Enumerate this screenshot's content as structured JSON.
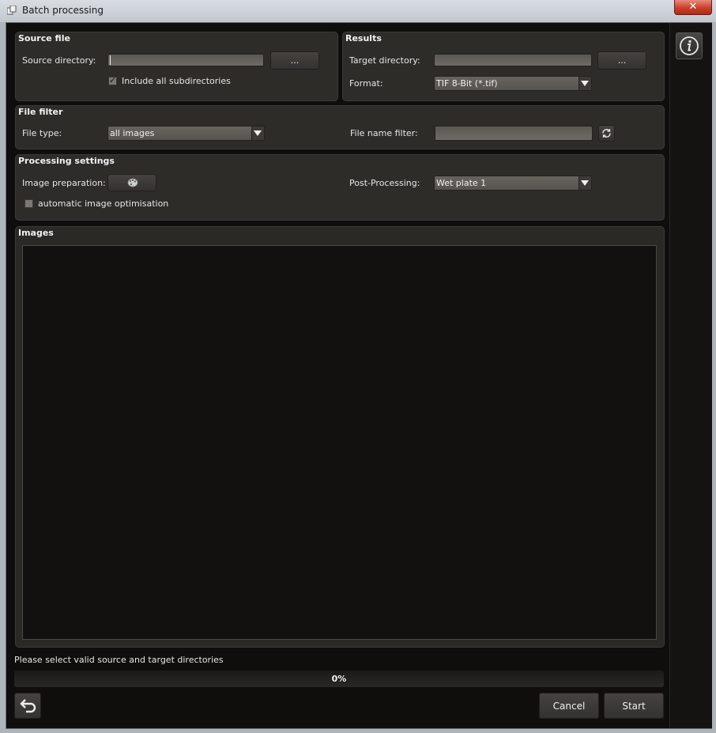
{
  "window": {
    "title": "Batch processing",
    "close_glyph": "✕"
  },
  "source_file": {
    "title": "Source file",
    "directory_label": "Source directory:",
    "directory_value": "",
    "browse_label": "...",
    "include_subdirs_label": "Include all subdirectories",
    "include_subdirs_checked": true
  },
  "results": {
    "title": "Results",
    "target_label": "Target directory:",
    "target_value": "",
    "browse_label": "...",
    "format_label": "Format:",
    "format_value": "TIF 8-Bit (*.tif)"
  },
  "file_filter": {
    "title": "File filter",
    "type_label": "File type:",
    "type_value": "all images",
    "name_filter_label": "File name filter:",
    "name_filter_value": ""
  },
  "processing": {
    "title": "Processing settings",
    "preparation_label": "Image preparation:",
    "post_label": "Post-Processing:",
    "post_value": "Wet plate 1",
    "auto_opt_label": "automatic image optimisation",
    "auto_opt_checked": false
  },
  "images": {
    "title": "Images"
  },
  "status": {
    "message": "Please select valid source and target directories"
  },
  "progress": {
    "value": 0,
    "label": "0%"
  },
  "actions": {
    "cancel": "Cancel",
    "start": "Start"
  },
  "icons": {
    "app": "batch-app-icon",
    "info": "info-icon",
    "refresh": "refresh-icon",
    "palette": "palette-icon",
    "undo": "undo-icon"
  }
}
